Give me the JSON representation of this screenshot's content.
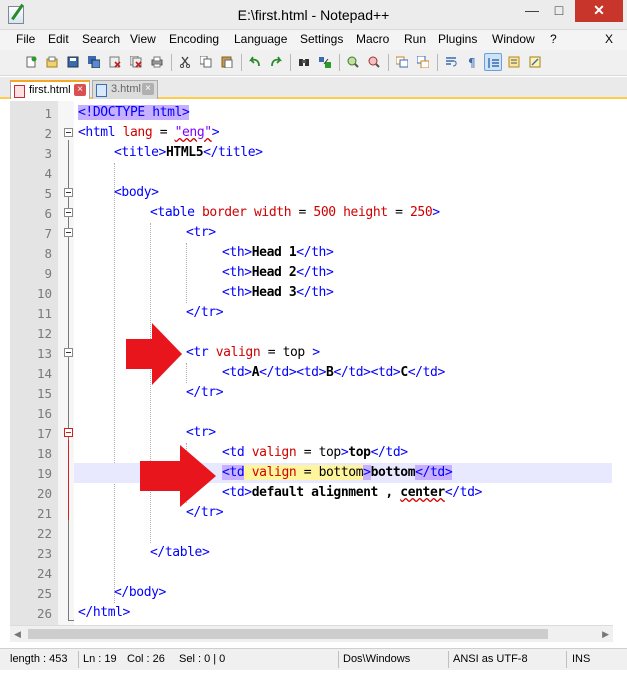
{
  "window": {
    "title": "E:\\first.html - Notepad++",
    "min_glyph": "—",
    "max_glyph": "□",
    "close_glyph": "✕"
  },
  "menu": {
    "items": [
      "File",
      "Edit",
      "Search",
      "View",
      "Encoding",
      "Language",
      "Settings",
      "Macro",
      "Run",
      "Plugins",
      "Window",
      "?"
    ],
    "close": "X"
  },
  "tabs": [
    {
      "label": "first.html",
      "active": true
    },
    {
      "label": "3.html",
      "active": false
    }
  ],
  "editor": {
    "lines": [
      {
        "no": "1"
      },
      {
        "no": "2"
      },
      {
        "no": "3"
      },
      {
        "no": "4"
      },
      {
        "no": "5"
      },
      {
        "no": "6"
      },
      {
        "no": "7"
      },
      {
        "no": "8"
      },
      {
        "no": "9"
      },
      {
        "no": "10"
      },
      {
        "no": "11"
      },
      {
        "no": "12"
      },
      {
        "no": "13"
      },
      {
        "no": "14"
      },
      {
        "no": "15"
      },
      {
        "no": "16"
      },
      {
        "no": "17"
      },
      {
        "no": "18"
      },
      {
        "no": "19"
      },
      {
        "no": "20"
      },
      {
        "no": "21"
      },
      {
        "no": "22"
      },
      {
        "no": "23"
      },
      {
        "no": "24"
      },
      {
        "no": "25"
      },
      {
        "no": "26"
      }
    ],
    "code": {
      "l1": {
        "a": "<!DOCTYPE html>"
      },
      "l2": {
        "a": "<html ",
        "b": "lang",
        "c": " = ",
        "d": "\"eng\"",
        "e": ">"
      },
      "l3": {
        "a": "<title>",
        "b": "HTML5",
        "c": "</title>"
      },
      "l5": {
        "a": "<body>"
      },
      "l6": {
        "a": "<table ",
        "b": "border width",
        "c": " = ",
        "d": "500",
        "e": " height",
        "f": " = ",
        "g": "250",
        "h": ">"
      },
      "l7": {
        "a": "<tr>"
      },
      "l8": {
        "a": "<th>",
        "b": "Head 1",
        "c": "</th>"
      },
      "l9": {
        "a": "<th>",
        "b": "Head 2",
        "c": "</th>"
      },
      "l10": {
        "a": "<th>",
        "b": "Head 3",
        "c": "</th>"
      },
      "l11": {
        "a": "</tr>"
      },
      "l13": {
        "a": "<tr ",
        "b": "valign",
        "c": " = ",
        "d": "top",
        "e": " >"
      },
      "l14": {
        "a": "<td>",
        "b": "A",
        "c": "</td>",
        "d": "<td>",
        "e": "B",
        "f": "</td>",
        "g": "<td>",
        "h": "C",
        "i": "</td>"
      },
      "l15": {
        "a": "</tr>"
      },
      "l17": {
        "a": "<tr>"
      },
      "l18": {
        "a": "<td ",
        "b": "valign",
        "c": " = ",
        "d": "top",
        "e": ">",
        "f": "top",
        "g": "</td>"
      },
      "l19": {
        "a": "<td",
        "b": " ",
        "c1": "vali",
        "c2": "gn",
        "d": " = ",
        "e": "bottom",
        "f": ">",
        "g": "bottom",
        "h": "</td>"
      },
      "l20": {
        "a": "<td>",
        "b": "default alignment , ",
        "c": "center",
        "d": "</td>"
      },
      "l21": {
        "a": "</tr>"
      },
      "l23": {
        "a": "</table>"
      },
      "l25": {
        "a": "</body>"
      },
      "l26": {
        "a": "</html>"
      }
    }
  },
  "status": {
    "length": "length : 453",
    "ln": "Ln : 19",
    "col": "Col : 26",
    "sel": "Sel : 0 | 0",
    "eol": "Dos\\Windows",
    "encoding": "ANSI as UTF-8",
    "mode": "INS"
  },
  "colors": {
    "tag": "#0000ff",
    "attribute": "#d00000",
    "value": "#8000ff",
    "current_line": "#e8e8ff",
    "arrow": "#e8161c",
    "tab_accent": "#f5a623"
  },
  "icons": [
    "notepad-plus-plus-icon",
    "new-file-icon",
    "open-file-icon",
    "save-icon",
    "save-all-icon",
    "close-icon",
    "close-all-icon",
    "print-icon",
    "cut-icon",
    "copy-icon",
    "paste-icon",
    "undo-icon",
    "redo-icon",
    "find-icon",
    "replace-icon",
    "zoom-in-icon",
    "zoom-out-icon",
    "sync-vertical-icon",
    "sync-horizontal-icon",
    "word-wrap-icon",
    "show-all-chars-icon",
    "indent-guide-icon",
    "doc-map-icon",
    "function-list-icon"
  ]
}
